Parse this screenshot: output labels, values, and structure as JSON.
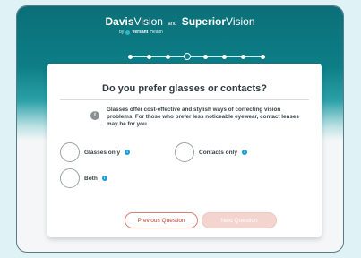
{
  "header": {
    "brand_a_bold": "Davis",
    "brand_a_rest": "Vision",
    "brand_joiner": "and",
    "brand_b_bold": "Superior",
    "brand_b_rest": "Vision",
    "by_text": "by",
    "parent_bold": "Versant",
    "parent_rest": "Health"
  },
  "progress": {
    "total_steps": 8,
    "current_step": 4
  },
  "question": {
    "title": "Do you prefer glasses or contacts?",
    "info": "Glasses offer cost-effective and stylish ways of correcting vision problems. For those who prefer less noticeable eyewear, contact lenses may be for you."
  },
  "options": [
    {
      "label": "Glasses only"
    },
    {
      "label": "Contacts only"
    },
    {
      "label": "Both"
    }
  ],
  "buttons": {
    "previous": "Previous Question",
    "next": "Next Question"
  },
  "icons": {
    "info": "info-icon",
    "option_info": "i"
  },
  "colors": {
    "header_teal": "#0d7e86",
    "accent_red": "#c0432e",
    "info_blue": "#1a9bd7"
  }
}
